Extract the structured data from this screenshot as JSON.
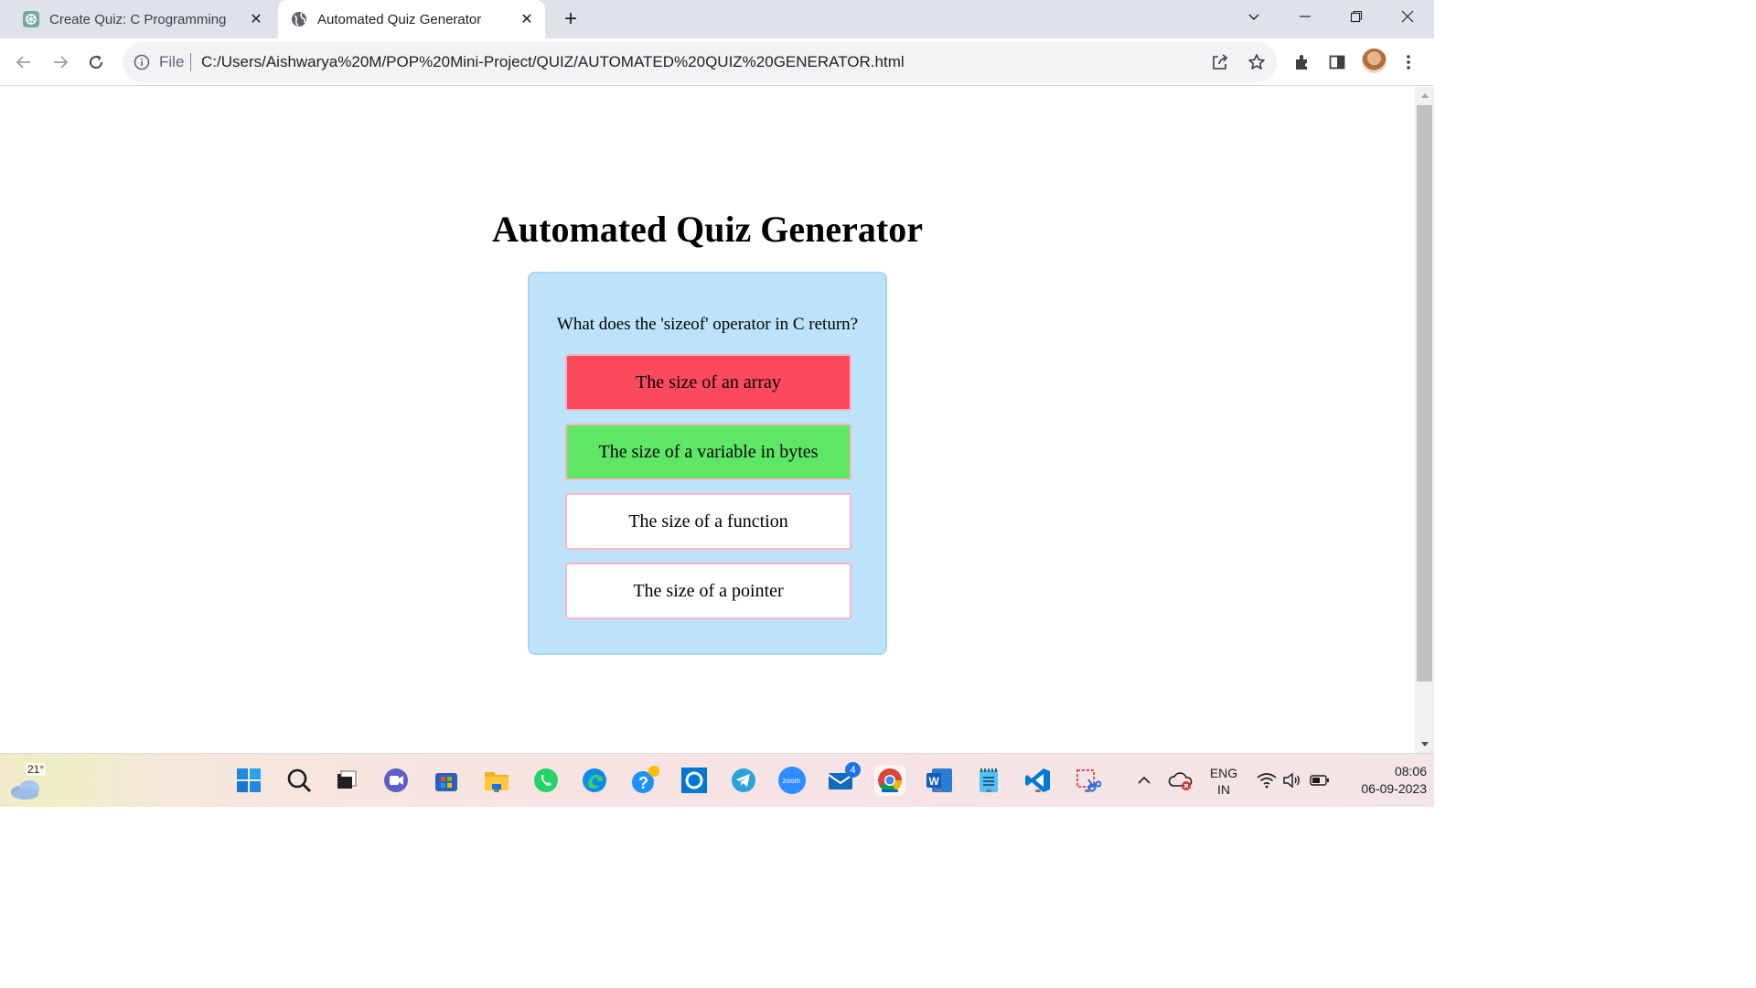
{
  "browser": {
    "tabs": [
      {
        "title": "Create Quiz: C Programming",
        "favicon": "chatgpt-icon",
        "active": false
      },
      {
        "title": "Automated Quiz Generator",
        "favicon": "globe-icon",
        "active": true
      }
    ],
    "new_tab": "+",
    "address": {
      "scheme_label": "File",
      "url": "C:/Users/Aishwarya%20M/POP%20Mini-Project/QUIZ/AUTOMATED%20QUIZ%20GENERATOR.html"
    }
  },
  "page": {
    "title": "Automated Quiz Generator",
    "question": "What does the 'sizeof' operator in C return?",
    "options": [
      {
        "label": "The size of an array",
        "state": "wrong",
        "color": "#fb4a5e"
      },
      {
        "label": "The size of a variable in bytes",
        "state": "correct",
        "color": "#5ee765"
      },
      {
        "label": "The size of a function",
        "state": "default",
        "color": "#ffffff"
      },
      {
        "label": "The size of a pointer",
        "state": "default",
        "color": "#ffffff"
      }
    ],
    "card_color": "#bde3fb"
  },
  "taskbar": {
    "weather_temp": "21°",
    "mail_badge": "4",
    "apps": [
      "start-icon",
      "search-icon",
      "task-view-icon",
      "teams-chat-icon",
      "store-icon",
      "file-explorer-icon",
      "whatsapp-icon",
      "edge-icon",
      "get-help-icon",
      "cortana-icon",
      "telegram-icon",
      "zoom-icon",
      "mail-icon",
      "chrome-icon",
      "word-icon",
      "notepad-icon",
      "vscode-icon",
      "snipping-tool-icon"
    ],
    "zoom_label": "zoom",
    "word_label": "W",
    "tray": {
      "lang_line1": "ENG",
      "lang_line2": "IN",
      "time": "08:06",
      "date": "06-09-2023"
    }
  }
}
